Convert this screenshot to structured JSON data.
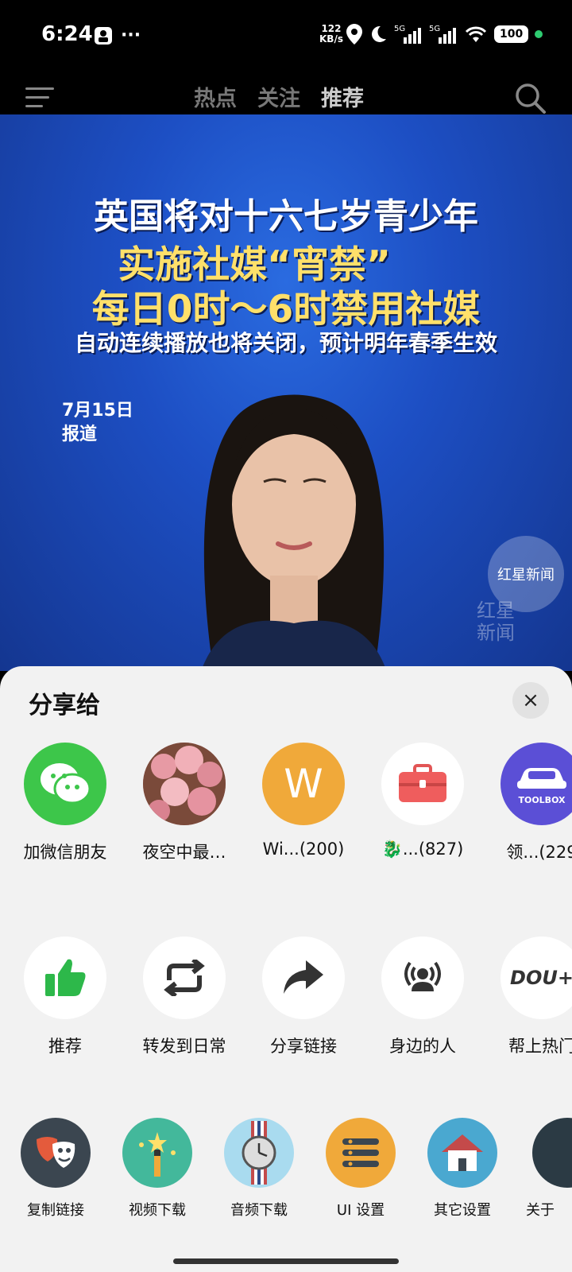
{
  "status": {
    "time": "6:24",
    "speed_value": "122",
    "speed_unit": "KB/s",
    "battery": "100"
  },
  "nav": {
    "tabs": [
      "热点",
      "关注",
      "推荐"
    ],
    "active_tab": "推荐"
  },
  "video": {
    "line1": "英国将对十六七岁青少年",
    "line2": "实施社媒“宵禁”",
    "line3": "每日0时～6时禁用社媒",
    "line4": "自动连续播放也将关闭，预计明年春季生效",
    "date_line1": "7月15日",
    "date_line2": "报道",
    "watermark": "红星新闻",
    "watermark_vertical_1": "红星",
    "watermark_vertical_2": "新闻"
  },
  "sheet": {
    "title": "分享给",
    "close": "×",
    "contacts": [
      {
        "label": "加微信朋友",
        "icon": "wechat-icon"
      },
      {
        "label": "夜空中最…",
        "icon": "roses-avatar"
      },
      {
        "label": "Wi...(200)",
        "icon": "w-avatar",
        "letter": "W"
      },
      {
        "label": "🐉...(827)",
        "icon": "toolbox-red-icon"
      },
      {
        "label": "领...(229",
        "icon": "car-toolbox-avatar",
        "badge": "TOOLBOX"
      }
    ],
    "actions": [
      {
        "label": "推荐",
        "icon": "thumbs-up-icon"
      },
      {
        "label": "转发到日常",
        "icon": "repost-icon"
      },
      {
        "label": "分享链接",
        "icon": "share-arrow-icon"
      },
      {
        "label": "身边的人",
        "icon": "nearby-people-icon"
      },
      {
        "label": "帮上热门",
        "icon": "dou-plus-icon",
        "text": "DOU+"
      }
    ],
    "tools": [
      {
        "label": "复制链接",
        "icon": "mask-icon"
      },
      {
        "label": "视频下载",
        "icon": "magic-wand-icon"
      },
      {
        "label": "音频下载",
        "icon": "watch-icon"
      },
      {
        "label": "UI 设置",
        "icon": "list-settings-icon"
      },
      {
        "label": "其它设置",
        "icon": "house-icon"
      },
      {
        "label": "关于",
        "icon": "about-icon"
      }
    ]
  }
}
